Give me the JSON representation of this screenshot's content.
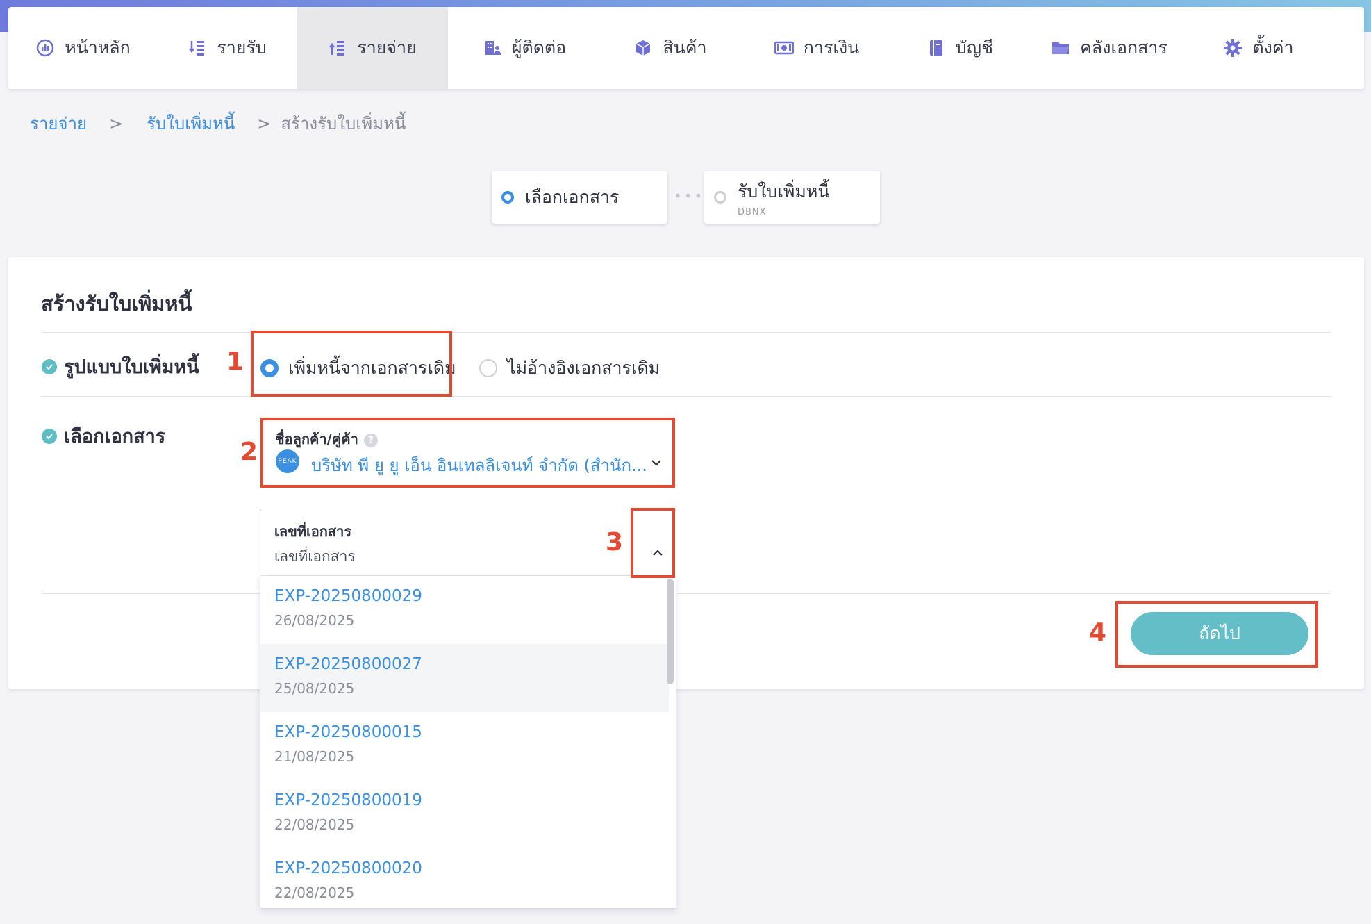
{
  "nav": {
    "items": [
      {
        "label": "หน้าหลัก",
        "icon": "dashboard-icon"
      },
      {
        "label": "รายรับ",
        "icon": "income-icon"
      },
      {
        "label": "รายจ่าย",
        "icon": "expense-icon",
        "active": true
      },
      {
        "label": "ผู้ติดต่อ",
        "icon": "contacts-icon"
      },
      {
        "label": "สินค้า",
        "icon": "product-box-icon"
      },
      {
        "label": "การเงิน",
        "icon": "money-icon"
      },
      {
        "label": "บัญชี",
        "icon": "ledger-icon"
      },
      {
        "label": "คลังเอกสาร",
        "icon": "folder-icon"
      },
      {
        "label": "ตั้งค่า",
        "icon": "gear-icon"
      }
    ]
  },
  "breadcrumb": {
    "items": [
      "รายจ่าย",
      "รับใบเพิ่มหนี้",
      "สร้างรับใบเพิ่มหนี้"
    ],
    "separator": ">"
  },
  "steps": [
    {
      "label": "เลือกเอกสาร",
      "sub": ""
    },
    {
      "label": "รับใบเพิ่มหนี้",
      "sub": "DBNX"
    }
  ],
  "form": {
    "title": "สร้างรับใบเพิ่มหนี้",
    "format_label": "รูปแบบใบเพิ่มหนี้",
    "option_from_doc": "เพิ่มหนี้จากเอกสารเดิม",
    "option_no_ref": "ไม่อ้างอิงเอกสารเดิม",
    "select_doc_label": "เลือกเอกสาร",
    "contact_label": "ชื่อลูกค้า/คู่ค้า",
    "contact_help": "?",
    "contact_avatar": "PEAK",
    "contact_value": "บริษัท พี ยู ยู เอ็น อินเทลลิเจนท์ จำกัด (สำนัก...",
    "docno_label": "เลขที่เอกสาร",
    "docno_placeholder": "เลขที่เอกสาร",
    "next_button": "ถัดไป"
  },
  "annotations": [
    "1",
    "2",
    "3",
    "4"
  ],
  "dropdown": {
    "items": [
      {
        "code": "EXP-20250800029",
        "date": "26/08/2025"
      },
      {
        "code": "EXP-20250800027",
        "date": "25/08/2025"
      },
      {
        "code": "EXP-20250800015",
        "date": "21/08/2025"
      },
      {
        "code": "EXP-20250800019",
        "date": "22/08/2025"
      },
      {
        "code": "EXP-20250800020",
        "date": "22/08/2025"
      }
    ]
  },
  "colors": {
    "accent": "#3b8fe0",
    "teal_button": "#64bec8",
    "annotation_red": "#e34a33",
    "check_teal": "#5fbdc4"
  }
}
